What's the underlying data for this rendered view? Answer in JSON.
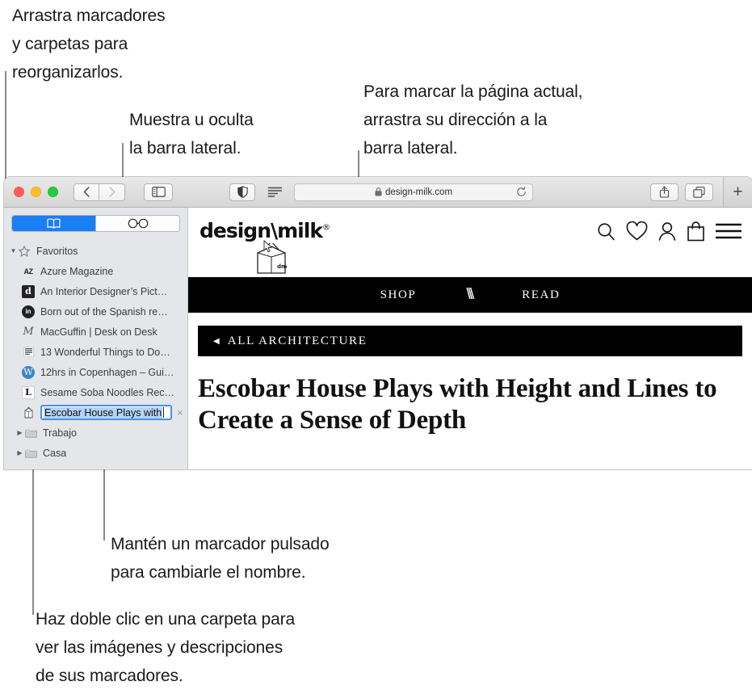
{
  "annotations": {
    "top_left": "Arrastra marcadores\ny carpetas para\nreorganizarlos.",
    "sidebar_toggle": "Muestra u oculta\nla barra lateral.",
    "address_bar": "Para marcar la página actual,\narrastra su dirección a la\nbarra lateral.",
    "rename": "Mantén un marcador pulsado\npara cambiarle el nombre.",
    "folder": "Haz doble clic en una carpeta para\nver las imágenes y descripciones\nde sus marcadores."
  },
  "window": {
    "traffic_lights": [
      "close-button",
      "minimize-button",
      "zoom-button"
    ],
    "back_label": "‹",
    "forward_label": "›",
    "sidebar_toggle_icon": "sidebar-icon",
    "reader_icon": "shield-icon",
    "reader_view_icon": "reader-lines-icon",
    "address": {
      "lock_icon": "lock-icon",
      "url": "design-milk.com",
      "reload_icon": "reload-icon"
    },
    "share_icon": "share-icon",
    "tabs_icon": "show-tabs-icon",
    "new_tab_label": "+"
  },
  "sidebar": {
    "segments": [
      {
        "name": "bookmarks",
        "icon": "book-icon",
        "active": true
      },
      {
        "name": "reading-list",
        "icon": "glasses-icon",
        "active": false
      }
    ],
    "group": {
      "label": "Favoritos",
      "icon": "star-icon",
      "expanded": true
    },
    "bookmarks": [
      {
        "label": "Azure Magazine",
        "favicon": "AZ"
      },
      {
        "label": "An Interior Designer’s Pict…",
        "favicon": "d"
      },
      {
        "label": "Born out of the Spanish re…",
        "favicon": "in"
      },
      {
        "label": "MacGuffin | Desk on Desk",
        "favicon": "M"
      },
      {
        "label": "13 Wonderful Things to Do…",
        "favicon": "grid"
      },
      {
        "label": "12hrs in Copenhagen – Gui…",
        "favicon": "W"
      },
      {
        "label": "Sesame Soba Noodles Rec…",
        "favicon": "L"
      }
    ],
    "editing_bookmark": {
      "value": "Escobar House Plays with",
      "favicon": "milk-carton",
      "delete_label": "×"
    },
    "folders": [
      {
        "label": "Trabajo",
        "icon": "folder-icon"
      },
      {
        "label": "Casa",
        "icon": "folder-icon"
      }
    ]
  },
  "site": {
    "logo_text": "design\\milk",
    "logo_reg": "®",
    "carton_label": "dm",
    "header_icons": [
      "search-icon",
      "heart-icon",
      "account-icon",
      "shopping-bag-icon",
      "menu-icon"
    ],
    "nav": [
      {
        "label": "SHOP"
      },
      {
        "label": "\\\\\\"
      },
      {
        "label": "READ"
      }
    ],
    "category": {
      "arrow": "◀",
      "label": "ALL ARCHITECTURE"
    },
    "headline": "Escobar House Plays with Height and Lines to Create a Sense of Depth"
  },
  "colors": {
    "accent_blue": "#1a7ef5",
    "selection_blue": "#b3d3f5",
    "sidebar_bg": "#e4e6e9",
    "nav_black": "#000000",
    "leader_gray": "#8a8a8a"
  }
}
